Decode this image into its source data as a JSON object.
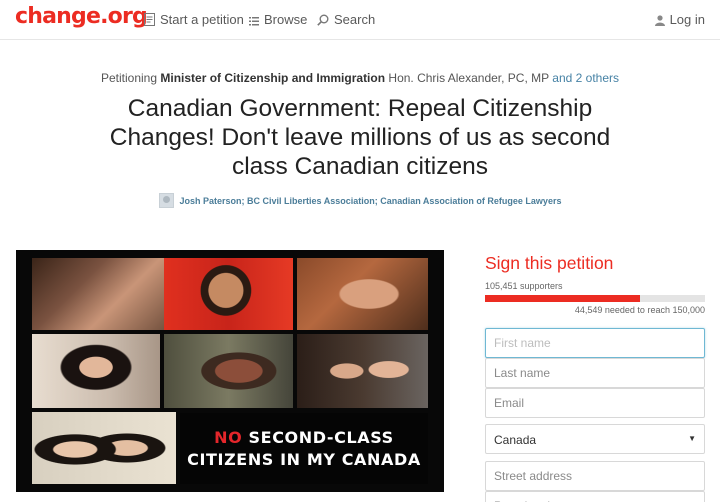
{
  "header": {
    "logo": "change.org",
    "nav": {
      "start": "Start a petition",
      "browse": "Browse",
      "search": "Search",
      "login": "Log in"
    }
  },
  "petition": {
    "petitioning_prefix": "Petitioning",
    "target_primary": "Minister of Citizenship and Immigration",
    "target_rest": "Hon. Chris Alexander, PC, MP",
    "others_link": "and 2 others",
    "title": "Canadian Government: Repeal Citizenship Changes! Don't leave millions of us as second class Canadian citizens",
    "authors": "Josh Paterson; BC Civil Liberties Association; Canadian Association of Refugee Lawyers"
  },
  "image": {
    "banner_no": "NO",
    "banner_line1_rest": " SECOND-CLASS",
    "banner_line2": "CITIZENS IN MY CANADA"
  },
  "sign": {
    "title": "Sign this petition",
    "supporters": "105,451 supporters",
    "needed": "44,549 needed to reach 150,000",
    "progress_percent": 70.3,
    "first_name_placeholder": "First name",
    "last_name_placeholder": "Last name",
    "email_placeholder": "Email",
    "country": "Canada",
    "street_placeholder": "Street address",
    "postal_placeholder": "Postal code"
  },
  "colors": {
    "brand": "#ec2c22",
    "link": "#4682a5",
    "focus": "#6fb8d3"
  },
  "icons": {
    "start": "petition-doc-icon",
    "browse": "list-icon",
    "search": "search-icon",
    "login": "user-icon"
  }
}
